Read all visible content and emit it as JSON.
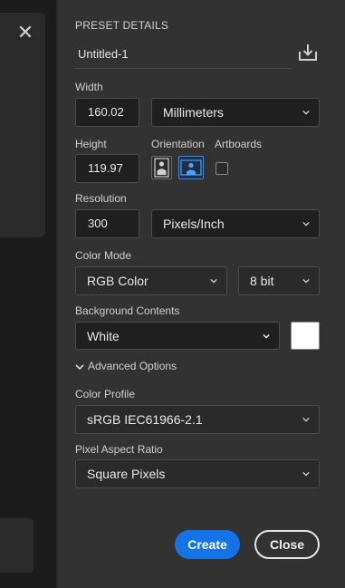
{
  "window": {
    "close_glyph": "✕"
  },
  "preset": {
    "section_title": "PRESET DETAILS",
    "name": "Untitled-1",
    "save_icon": "save-preset-icon"
  },
  "width": {
    "label": "Width",
    "value": "160.02",
    "unit": "Millimeters"
  },
  "height": {
    "label": "Height",
    "value": "119.97"
  },
  "orientation": {
    "label": "Orientation",
    "selected": "landscape"
  },
  "artboards": {
    "label": "Artboards",
    "checked": false
  },
  "resolution": {
    "label": "Resolution",
    "value": "300",
    "unit": "Pixels/Inch"
  },
  "color_mode": {
    "label": "Color Mode",
    "mode": "RGB Color",
    "bits": "8 bit"
  },
  "background": {
    "label": "Background Contents",
    "value": "White",
    "swatch_color": "#ffffff"
  },
  "advanced": {
    "label": "Advanced Options"
  },
  "color_profile": {
    "label": "Color Profile",
    "value": "sRGB IEC61966-2.1"
  },
  "pixel_aspect": {
    "label": "Pixel Aspect Ratio",
    "value": "Square Pixels"
  },
  "buttons": {
    "create": "Create",
    "close": "Close"
  },
  "colors": {
    "accent": "#1473e6",
    "panel": "#323232",
    "field": "#1f1f1f"
  }
}
